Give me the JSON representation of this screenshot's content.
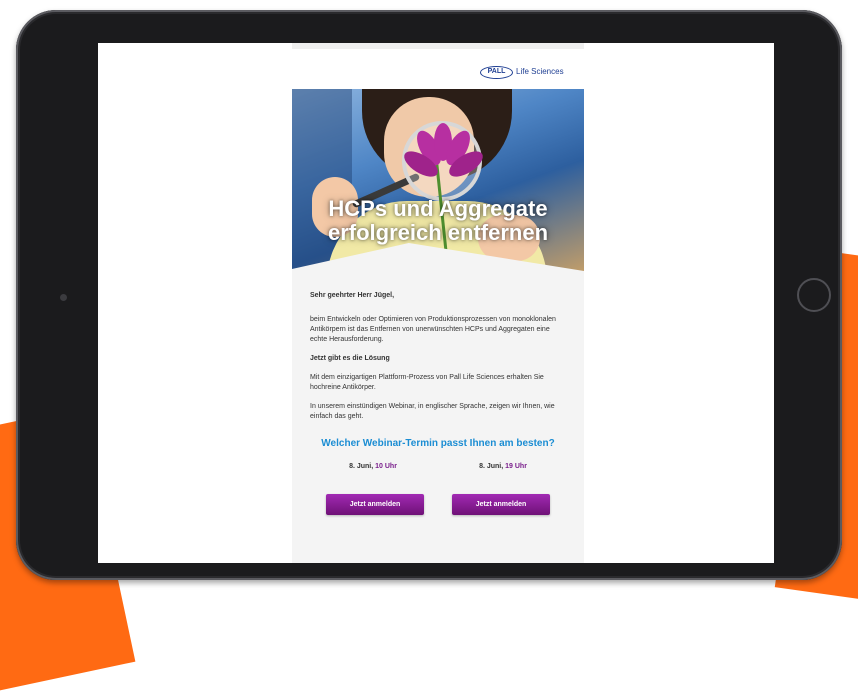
{
  "brand": {
    "logo_mark": "PALL",
    "logo_text": "Life Sciences",
    "logo_color": "#1f3f93"
  },
  "hero": {
    "headline": "HCPs und Aggregate erfolgreich entfernen"
  },
  "email": {
    "greeting": "Sehr geehrter Herr Jügel,",
    "intro": "beim Entwickeln oder Optimieren von Produktionsprozessen von monoklonalen Antikörpern ist das Entfernen von unerwünschten HCPs und Aggregaten eine echte Herausforderung.",
    "subheading": "Jetzt gibt es die Lösung",
    "paragraph_2": "Mit dem einzigartigen Plattform-Prozess von Pall Life Sciences erhalten Sie hochreine Antikörper.",
    "paragraph_3": "In unserem einstündigen Webinar, in englischer Sprache, zeigen wir Ihnen, wie einfach das geht.",
    "question": "Welcher Webinar-Termin passt Ihnen am besten?",
    "sessions": [
      {
        "date": "8. Juni,",
        "time": "10 Uhr",
        "button_label": "Jetzt anmelden"
      },
      {
        "date": "8. Juni,",
        "time": "19 Uhr",
        "button_label": "Jetzt anmelden"
      }
    ]
  },
  "colors": {
    "accent_blue": "#1b8dd3",
    "button_purple": "#8e1ea0",
    "background_orange": "#ff6a13"
  }
}
